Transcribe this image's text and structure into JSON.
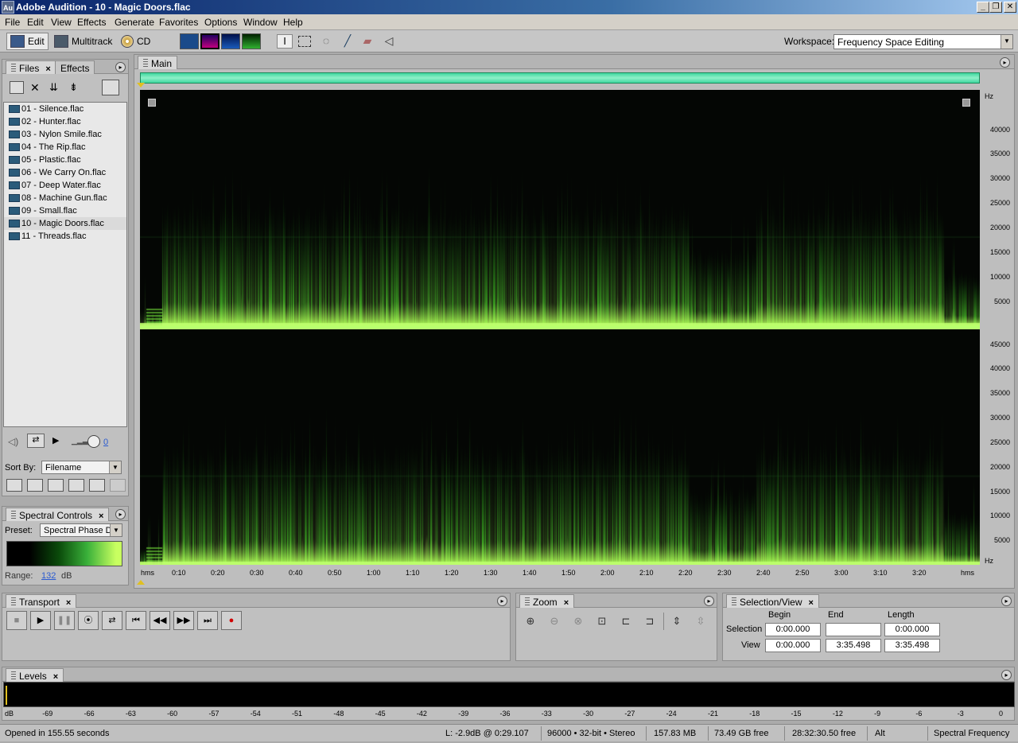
{
  "window": {
    "title": "Adobe Audition - 10 - Magic Doors.flac",
    "app_icon": "Au"
  },
  "menu": [
    "File",
    "Edit",
    "View",
    "Effects",
    "Generate",
    "Favorites",
    "Options",
    "Window",
    "Help"
  ],
  "toolbar": {
    "edit_label": "Edit",
    "multitrack_label": "Multitrack",
    "cd_label": "CD",
    "workspace_label": "Workspace:",
    "workspace_value": "Frequency Space Editing"
  },
  "files_panel": {
    "tab_files": "Files",
    "tab_effects": "Effects",
    "files": [
      "01 - Silence.flac",
      "02 - Hunter.flac",
      "03 - Nylon Smile.flac",
      "04 - The Rip.flac",
      "05 - Plastic.flac",
      "06 - We Carry On.flac",
      "07 - Deep Water.flac",
      "08 - Machine Gun.flac",
      "09 - Small.flac",
      "10 - Magic Doors.flac",
      "11 - Threads.flac"
    ],
    "selected_index": 9,
    "volume_value": "0",
    "sort_by_label": "Sort By:",
    "sort_by_value": "Filename"
  },
  "spectral_controls": {
    "tab": "Spectral Controls",
    "preset_label": "Preset:",
    "preset_value": "Spectral Phase D",
    "range_label": "Range:",
    "range_value": "132",
    "range_unit": "dB"
  },
  "main_panel": {
    "tab": "Main",
    "hz_unit": "Hz",
    "top_channel_ticks": [
      "40000",
      "35000",
      "30000",
      "25000",
      "20000",
      "15000",
      "10000",
      "5000"
    ],
    "bottom_channel_ticks": [
      "45000",
      "40000",
      "35000",
      "30000",
      "25000",
      "20000",
      "15000",
      "10000",
      "5000"
    ],
    "time_unit": "hms",
    "time_ticks": [
      "0:10",
      "0:20",
      "0:30",
      "0:40",
      "0:50",
      "1:00",
      "1:10",
      "1:20",
      "1:30",
      "1:40",
      "1:50",
      "2:00",
      "2:10",
      "2:20",
      "2:30",
      "2:40",
      "2:50",
      "3:00",
      "3:10",
      "3:20"
    ]
  },
  "transport": {
    "tab": "Transport"
  },
  "zoom": {
    "tab": "Zoom"
  },
  "selection_view": {
    "tab": "Selection/View",
    "col_begin": "Begin",
    "col_end": "End",
    "col_length": "Length",
    "selection_label": "Selection",
    "view_label": "View",
    "selection_begin": "0:00.000",
    "selection_end": "",
    "selection_length": "0:00.000",
    "view_begin": "0:00.000",
    "view_end": "3:35.498",
    "view_length": "3:35.498"
  },
  "levels": {
    "tab": "Levels",
    "unit": "dB",
    "ticks": [
      "-69",
      "-66",
      "-63",
      "-60",
      "-57",
      "-54",
      "-51",
      "-48",
      "-45",
      "-42",
      "-39",
      "-36",
      "-33",
      "-30",
      "-27",
      "-24",
      "-21",
      "-18",
      "-15",
      "-12",
      "-9",
      "-6",
      "-3",
      "0"
    ]
  },
  "status": {
    "message": "Opened in 155.55 seconds",
    "level_position": "L: -2.9dB @   0:29.107",
    "format": "96000 • 32-bit • Stereo",
    "size": "157.83 MB",
    "free_space": "73.49 GB free",
    "free_time": "28:32:30.50 free",
    "modifier": "Alt",
    "view_mode": "Spectral Frequency"
  },
  "colors": {
    "spectrum_green": "#7cff3a",
    "overview_green": "#5fe8b0",
    "title_blue": "#0a246a"
  }
}
